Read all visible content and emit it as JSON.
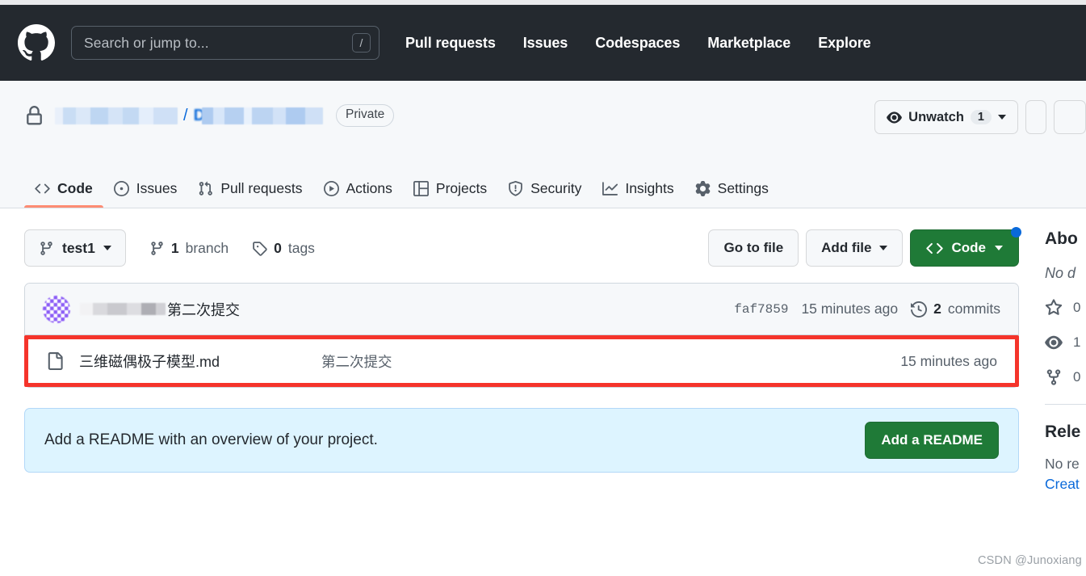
{
  "header": {
    "logo_icon": "github-mark-icon",
    "search": {
      "placeholder": "Search or jump to...",
      "shortcut": "/"
    },
    "nav": [
      {
        "label": "Pull requests"
      },
      {
        "label": "Issues"
      },
      {
        "label": "Codespaces"
      },
      {
        "label": "Marketplace"
      },
      {
        "label": "Explore"
      }
    ]
  },
  "repo": {
    "lock_icon": "lock-icon",
    "owner_redacted": true,
    "separator": "/",
    "name_prefix_visible": "D",
    "visibility_badge": "Private",
    "actions": {
      "unwatch_label": "Unwatch",
      "unwatch_count": "1",
      "unwatch_icon": "eye-icon"
    },
    "tabs": [
      {
        "label": "Code",
        "icon": "code-icon",
        "active": true
      },
      {
        "label": "Issues",
        "icon": "issue-opened-icon",
        "active": false
      },
      {
        "label": "Pull requests",
        "icon": "git-pull-request-icon",
        "active": false
      },
      {
        "label": "Actions",
        "icon": "play-icon",
        "active": false
      },
      {
        "label": "Projects",
        "icon": "table-icon",
        "active": false
      },
      {
        "label": "Security",
        "icon": "shield-icon",
        "active": false
      },
      {
        "label": "Insights",
        "icon": "graph-icon",
        "active": false
      },
      {
        "label": "Settings",
        "icon": "gear-icon",
        "active": false
      }
    ]
  },
  "toolbar": {
    "branch_name": "test1",
    "branch_icon": "git-branch-icon",
    "branches_count": "1",
    "branches_label": "branch",
    "tags_count": "0",
    "tags_label": "tags",
    "tag_icon": "tag-icon",
    "go_to_file": "Go to file",
    "add_file": "Add file",
    "code_button": "Code",
    "code_icon": "code-icon",
    "has_notification_dot": true
  },
  "commit_bar": {
    "author_redacted": true,
    "message": "第二次提交",
    "sha": "faf7859",
    "time": "15 minutes ago",
    "commits_count": "2",
    "commits_label": "commits",
    "history_icon": "history-icon"
  },
  "files": [
    {
      "icon": "file-icon",
      "name": "三维磁偶极子模型.md",
      "commit_message": "第二次提交",
      "time": "15 minutes ago",
      "highlighted": true
    }
  ],
  "readme_banner": {
    "text": "Add a README with an overview of your project.",
    "button_label": "Add a README"
  },
  "sidebar": {
    "about_title": "Abo",
    "description": "No d",
    "stats": [
      {
        "icon": "star-icon",
        "value": "0"
      },
      {
        "icon": "eye-icon",
        "value": "1"
      },
      {
        "icon": "fork-icon",
        "value": "0"
      }
    ],
    "releases_title": "Rele",
    "no_releases": "No re",
    "create_link": "Creat"
  },
  "watermark": "CSDN @Junoxiang",
  "colors": {
    "header_bg": "#24292f",
    "repo_head_bg": "#f6f8fa",
    "accent_green": "#1f7a37",
    "accent_blue": "#0969da",
    "active_tab_underline": "#fd8c73",
    "highlight_red": "#f5342b",
    "banner_blue": "#ddf4ff"
  }
}
